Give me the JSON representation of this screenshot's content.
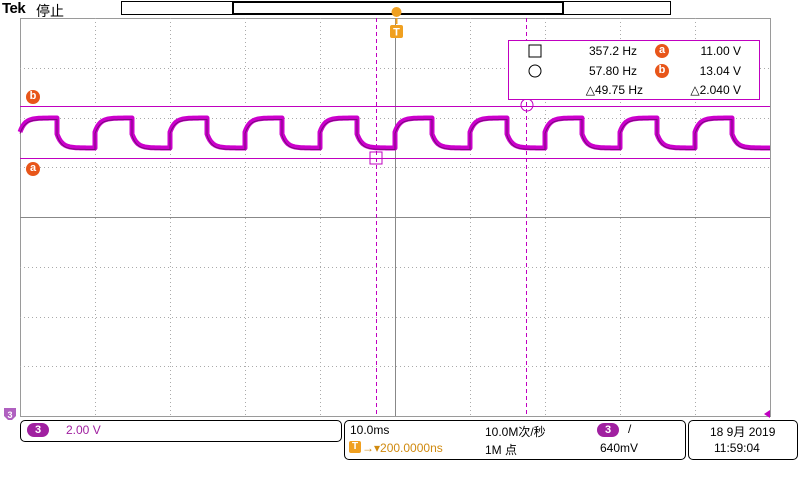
{
  "header": {
    "brand": "Tek",
    "status": "停止"
  },
  "trigger": {
    "top_marker": "T"
  },
  "cursors": {
    "square_freq": "357.2 Hz",
    "circle_freq": "57.80 Hz",
    "delta_freq": "△49.75 Hz",
    "a_label": "a",
    "a_value": "11.00 V",
    "b_label": "b",
    "b_value": "13.04 V",
    "delta_value": "△2.040 V"
  },
  "ref_markers": {
    "b": "b",
    "a": "a"
  },
  "bottom": {
    "ch_num": "3",
    "ch_scale": "2.00 V",
    "timebase": "10.0ms",
    "trig_delay": "→▾200.0000ns",
    "sample_rate": "10.0M次/秒",
    "record_len": "1M 点",
    "trig_ch": "3",
    "trig_slope": "/",
    "trig_level": "640mV",
    "date": "18 9月 2019",
    "time": "11:59:04"
  },
  "colors": {
    "waveform": "#cc00cc",
    "grid": "#9a9a9a",
    "cursor": "#c000c0",
    "trigger": "#f0a020",
    "badge": "#e8561a"
  }
}
